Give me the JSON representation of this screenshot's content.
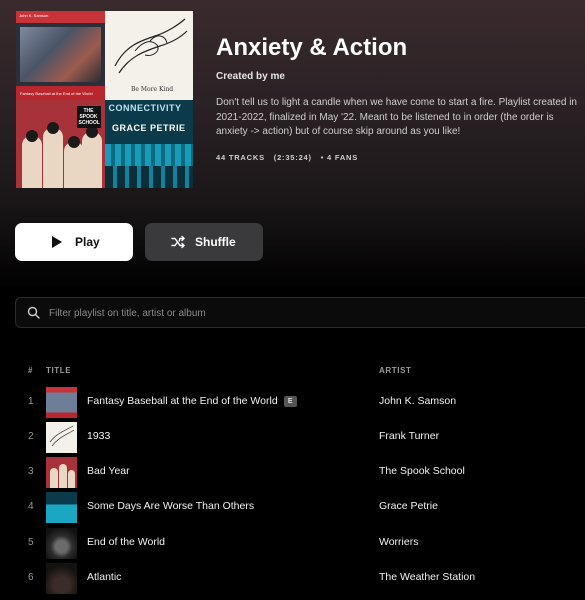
{
  "playlist": {
    "title": "Anxiety & Action",
    "created_by": "Created by me",
    "description": "Don't tell us to light a candle when we have come to start a fire. Playlist created in 2021-2022, finalized in May '22. Meant to be listened to in order (the order is anxiety -> action) but of course skip around as you like!",
    "track_count": "44 TRACKS",
    "duration": "(2:35:24)",
    "fans": "• 4 FANS"
  },
  "cover": {
    "art1_top": "John K. Samson",
    "art1_bottom": "Fantasy Baseball at the End of the World",
    "art2_caption": "Be More Kind",
    "art3_label": "THE SPOOK SCHOOL",
    "art4_line1": "CONNECTIVITY",
    "art4_line2": "GRACE PETRIE"
  },
  "actions": {
    "play_label": "Play",
    "shuffle_label": "Shuffle"
  },
  "filter": {
    "placeholder": "Filter playlist on title, artist or album",
    "value": ""
  },
  "table": {
    "headers": {
      "num": "#",
      "title": "TITLE",
      "artist": "ARTIST"
    },
    "rows": [
      {
        "num": "1",
        "title": "Fantasy Baseball at the End of the World",
        "explicit": "E",
        "artist": "John K. Samson"
      },
      {
        "num": "2",
        "title": "1933",
        "artist": "Frank Turner"
      },
      {
        "num": "3",
        "title": "Bad Year",
        "artist": "The Spook School"
      },
      {
        "num": "4",
        "title": "Some Days Are Worse Than Others",
        "artist": "Grace Petrie"
      },
      {
        "num": "5",
        "title": "End of the World",
        "artist": "Worriers"
      },
      {
        "num": "6",
        "title": "Atlantic",
        "artist": "The Weather Station"
      }
    ]
  },
  "icons": {
    "play": "play-icon",
    "shuffle": "shuffle-icon",
    "search": "search-icon"
  }
}
